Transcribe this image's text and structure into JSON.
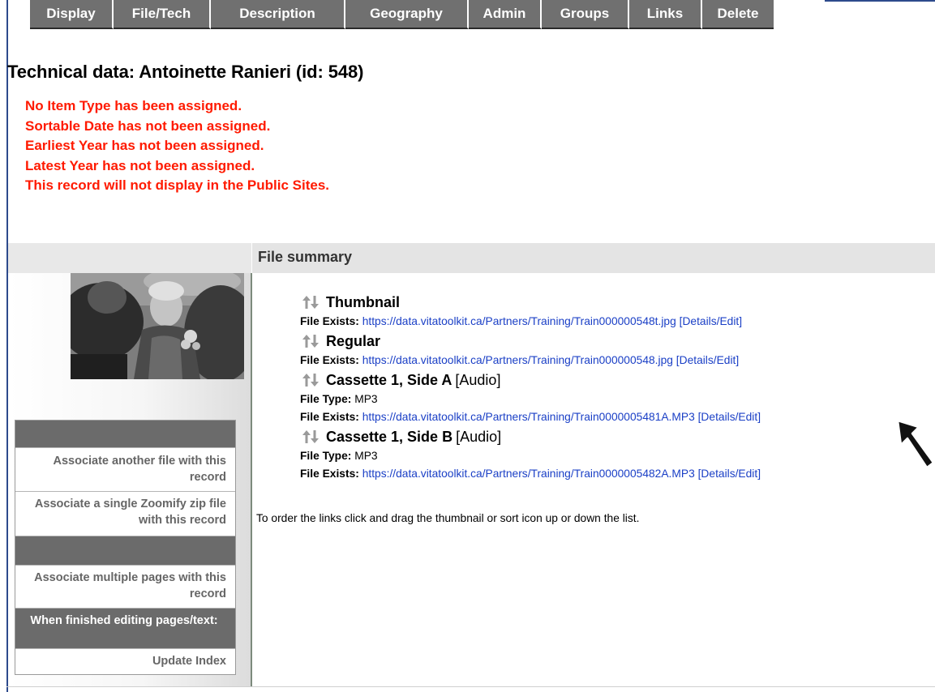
{
  "tabs": [
    {
      "label": "Display",
      "width": 103
    },
    {
      "label": "File/Tech",
      "width": 120
    },
    {
      "label": "Description",
      "width": 166
    },
    {
      "label": "Geography",
      "width": 152
    },
    {
      "label": "Admin",
      "width": 90
    },
    {
      "label": "Groups",
      "width": 108
    },
    {
      "label": "Links",
      "width": 90
    },
    {
      "label": "Delete",
      "width": 88
    }
  ],
  "page": {
    "title": "Technical data: Antoinette Ranieri (id: 548)",
    "warnings": [
      "No Item Type has been assigned.",
      "Sortable Date has not been assigned.",
      "Earliest Year has not been assigned.",
      "Latest Year has not been assigned.",
      "This record will not display in the Public Sites."
    ]
  },
  "summary": {
    "title": "File summary",
    "files": [
      {
        "name": "Thumbnail",
        "kind": "",
        "file_type": "",
        "exists_label": "File Exists:",
        "url": "https://data.vitatoolkit.ca/Partners/Training/Train000000548t.jpg",
        "edit": "[Details/Edit]"
      },
      {
        "name": "Regular",
        "kind": "",
        "file_type": "",
        "exists_label": "File Exists:",
        "url": "https://data.vitatoolkit.ca/Partners/Training/Train000000548.jpg",
        "edit": "[Details/Edit]"
      },
      {
        "name": "Cassette 1, Side A",
        "kind": "[Audio]",
        "type_label": "File Type:",
        "file_type": "MP3",
        "exists_label": "File Exists:",
        "url": "https://data.vitatoolkit.ca/Partners/Training/Train0000005481A.MP3",
        "edit": "[Details/Edit]"
      },
      {
        "name": "Cassette 1, Side B",
        "kind": "[Audio]",
        "type_label": "File Type:",
        "file_type": "MP3",
        "exists_label": "File Exists:",
        "url": "https://data.vitatoolkit.ca/Partners/Training/Train0000005482A.MP3",
        "edit": "[Details/Edit]"
      }
    ],
    "order_note": "To order the links click and drag the thumbnail or sort icon up or down the list."
  },
  "side_menu": {
    "associate_file": "Associate another file with this record",
    "associate_zoomify": "Associate a single Zoomify zip file with this record",
    "associate_pages": "Associate multiple pages with this record",
    "finished_label": "When finished editing pages/text:",
    "update_index": "Update Index"
  },
  "colors": {
    "warning": "#ff1a00",
    "link": "#1a3fc6",
    "tab_bg": "#707070"
  }
}
